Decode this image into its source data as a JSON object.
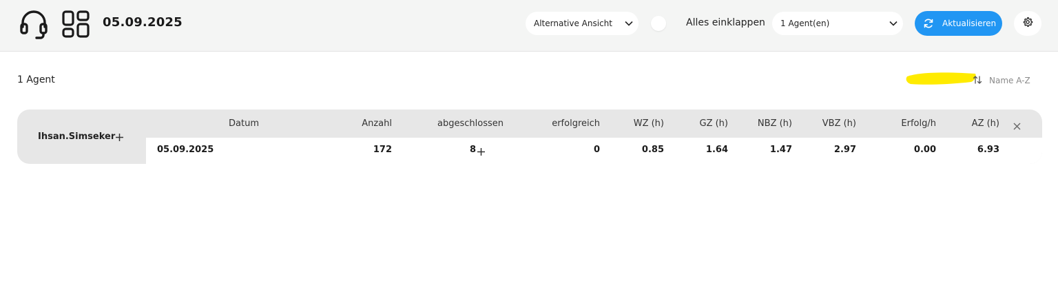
{
  "header": {
    "date": "05.09.2025",
    "view_select": {
      "value": "Alternative Ansicht"
    },
    "collapse_label": "Alles einklappen",
    "agent_select": {
      "value": "1 Agent(en)"
    },
    "refresh_label": "Aktualisieren",
    "icons": {
      "support": "headset-icon",
      "layout": "dashboard-grid-icon",
      "settings": "gear-icon",
      "refresh": "refresh-icon"
    }
  },
  "list": {
    "count_label": "1 Agent",
    "sort_label": "Name A-Z",
    "highlight_color": "#ffeb00"
  },
  "table": {
    "agent": "Ihsan.Simseker",
    "columns": [
      "Datum",
      "Anzahl",
      "abgeschlossen",
      "erfolgreich",
      "WZ (h)",
      "GZ (h)",
      "NBZ (h)",
      "VBZ (h)",
      "Erfolg/h",
      "AZ (h)"
    ],
    "rows": [
      [
        "05.09.2025",
        "172",
        "8",
        "0",
        "0.85",
        "1.64",
        "1.47",
        "2.97",
        "0.00",
        "6.93"
      ]
    ]
  },
  "colors": {
    "accent": "#2196f3",
    "topbar": "#f4f5f4",
    "card": "#e7e7e7"
  }
}
